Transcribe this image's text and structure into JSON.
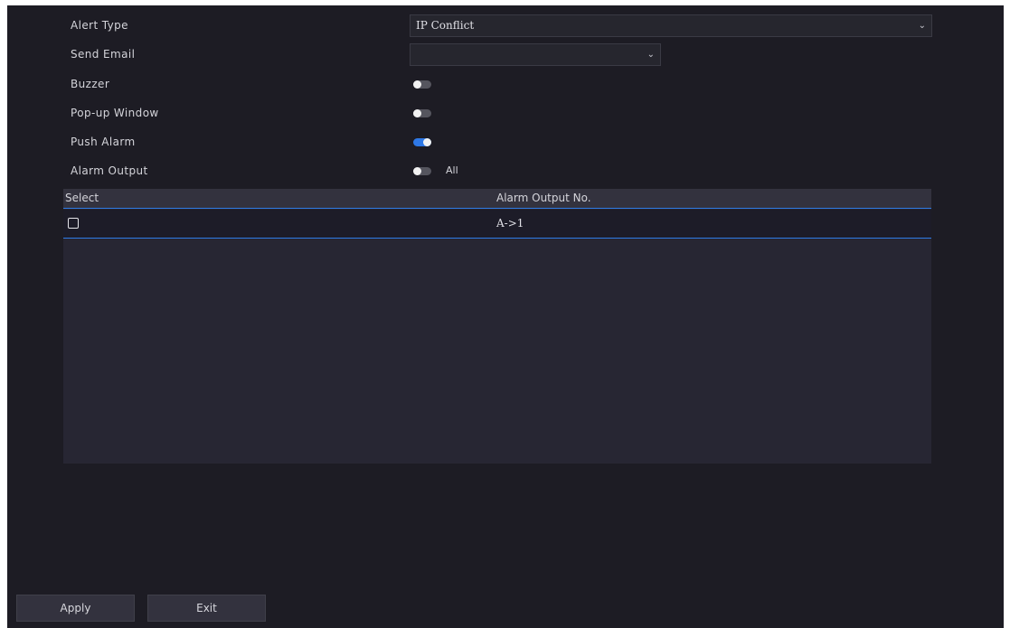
{
  "form": {
    "alert_type": {
      "label": "Alert Type",
      "value": "IP Conflict"
    },
    "send_email": {
      "label": "Send Email",
      "value": ""
    },
    "buzzer": {
      "label": "Buzzer",
      "enabled": false
    },
    "popup_window": {
      "label": "Pop-up Window",
      "enabled": false
    },
    "push_alarm": {
      "label": "Push Alarm",
      "enabled": true
    },
    "alarm_output": {
      "label": "Alarm Output",
      "all_enabled": false,
      "all_label": "All"
    }
  },
  "table": {
    "columns": [
      "Select",
      "Alarm Output No."
    ],
    "rows": [
      {
        "selected": false,
        "alarm_output_no": "A->1"
      }
    ]
  },
  "buttons": {
    "apply": "Apply",
    "exit": "Exit"
  },
  "colors": {
    "background": "#1d1c24",
    "accent": "#2e7be6",
    "table_bg": "#272633"
  }
}
